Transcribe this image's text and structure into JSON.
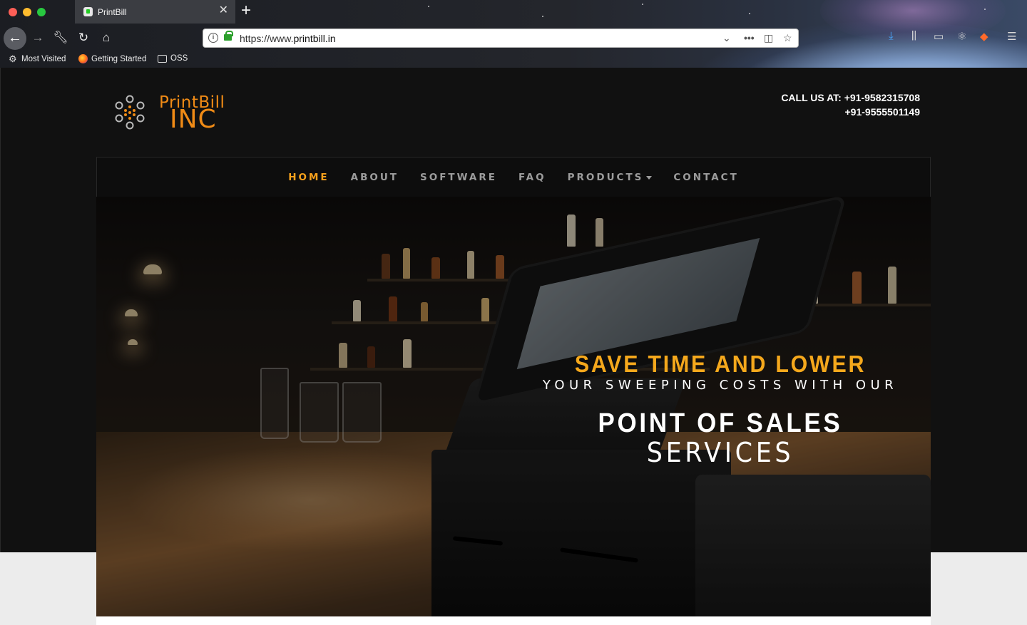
{
  "browser": {
    "tab_title": "PrintBill",
    "url_scheme": "https://www.",
    "url_host": "printbill.in",
    "bookmarks": [
      {
        "label": "Most Visited",
        "icon": "gear-icon"
      },
      {
        "label": "Getting Started",
        "icon": "firefox-icon"
      },
      {
        "label": "OSS",
        "icon": "folder-icon"
      }
    ]
  },
  "site": {
    "logo_top": "PrintBill",
    "logo_bottom": "INC",
    "call_line1": "CALL US AT: +91-9582315708",
    "call_line2": "+91-9555501149",
    "nav": {
      "home": "HOME",
      "about": "ABOUT",
      "software": "SOFTWARE",
      "faq": "FAQ",
      "products": "PRODUCTS",
      "contact": "CONTACT"
    },
    "hero": {
      "line1": "SAVE TIME AND LOWER",
      "line2": "YOUR SWEEPING COSTS WITH OUR",
      "line3": "POINT OF SALES",
      "line4": "SERVICES"
    }
  },
  "colors": {
    "accent": "#f5a81c",
    "brand": "#f08b16",
    "page_bg": "#111111",
    "nav_text": "#9c9c9c"
  }
}
